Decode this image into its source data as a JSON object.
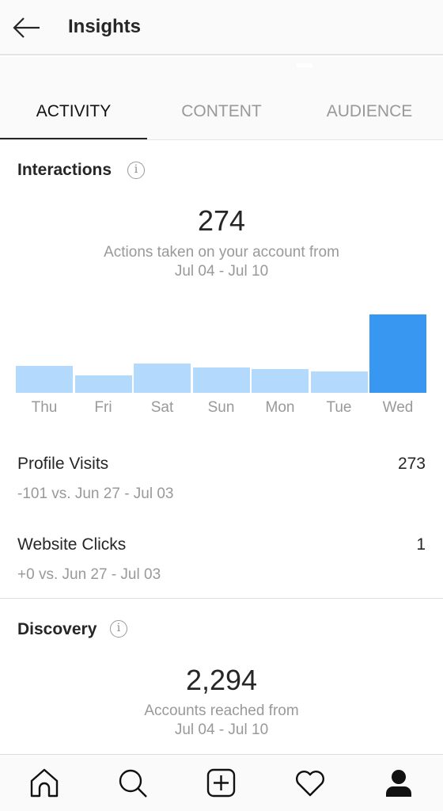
{
  "header": {
    "title": "Insights",
    "back_icon": "arrow-left-icon"
  },
  "tabs": [
    {
      "label": "ACTIVITY",
      "active": true
    },
    {
      "label": "CONTENT",
      "active": false
    },
    {
      "label": "AUDIENCE",
      "active": false
    }
  ],
  "interactions": {
    "title": "Interactions",
    "info_glyph": "i",
    "total": "274",
    "caption_line1": "Actions taken on your account from",
    "caption_line2": "Jul 04 - Jul 10"
  },
  "chart_data": {
    "type": "bar",
    "title": "",
    "xlabel": "",
    "ylabel": "",
    "categories": [
      "Thu",
      "Fri",
      "Sat",
      "Sun",
      "Mon",
      "Tue",
      "Wed"
    ],
    "values": [
      33,
      22,
      36,
      31,
      29,
      26,
      97
    ],
    "highlight_index": 6,
    "ylim": [
      0,
      97
    ],
    "grid": false,
    "colors": {
      "bar": "#b3d9fd",
      "highlight": "#3897f0"
    }
  },
  "metrics": [
    {
      "label": "Profile Visits",
      "value": "273",
      "comparison": "-101 vs. Jun 27 - Jul 03"
    },
    {
      "label": "Website Clicks",
      "value": "1",
      "comparison": "+0 vs. Jun 27 - Jul 03"
    }
  ],
  "discovery": {
    "title": "Discovery",
    "info_glyph": "i",
    "total": "2,294",
    "caption_line1": "Accounts reached from",
    "caption_line2": "Jul 04 - Jul 10"
  },
  "bottom_nav": [
    "home-icon",
    "search-icon",
    "add-post-icon",
    "heart-icon",
    "profile-icon"
  ]
}
